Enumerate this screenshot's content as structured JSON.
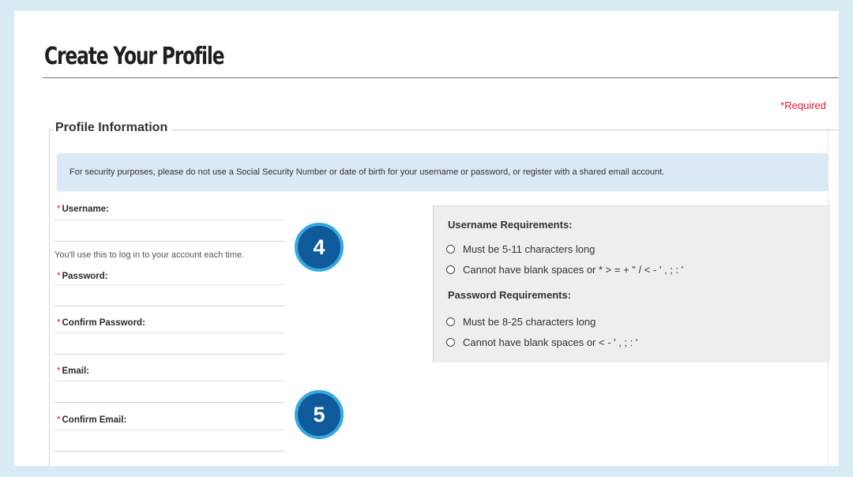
{
  "page": {
    "title": "Create Your Profile",
    "required_note": "*Required",
    "section_label": "Profile Information",
    "notice": "For security purposes, please do not use a Social Security Number or date of birth for your username or password, or register with a shared email account."
  },
  "form": {
    "star": "*",
    "username": {
      "label": "Username:",
      "value": "",
      "helper": "You'll use this to log in to your account each time."
    },
    "password": {
      "label": "Password:",
      "value": ""
    },
    "confirm_password": {
      "label": "Confirm Password:",
      "value": ""
    },
    "email": {
      "label": "Email:",
      "value": ""
    },
    "confirm_email": {
      "label": "Confirm Email:",
      "value": ""
    }
  },
  "requirements": {
    "username_title": "Username Requirements:",
    "username_items": [
      "Must be 5-11 characters long",
      "Cannot have blank spaces or * > = + \" / < - ' , ; : '"
    ],
    "password_title": "Password Requirements:",
    "password_items": [
      "Must be 8-25 characters long",
      "Cannot have blank spaces or < - ' , ; : '"
    ]
  },
  "badges": [
    "4",
    "5"
  ],
  "colors": {
    "frame": "#d8eaf4",
    "required": "#e0192f",
    "notice_bg": "#dbe8f5",
    "badge_fill": "#0f5a9a",
    "badge_ring": "#35a9e0"
  }
}
